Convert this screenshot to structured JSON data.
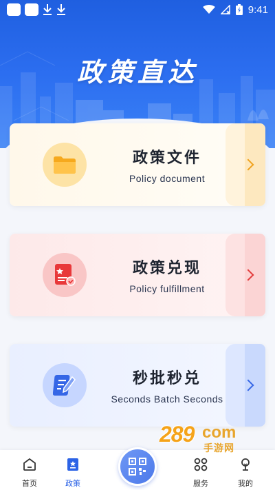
{
  "status_bar": {
    "time": "9:41"
  },
  "header": {
    "title": "政策直达"
  },
  "cards": [
    {
      "title": "政策文件",
      "subtitle": "Policy document",
      "icon": "folder-icon",
      "accent": "#f0a21e"
    },
    {
      "title": "政策兑现",
      "subtitle": "Policy fulfillment",
      "icon": "certificate-icon",
      "accent": "#e23a3a"
    },
    {
      "title": "秒批秒兑",
      "subtitle": "Seconds Batch Seconds",
      "icon": "document-edit-icon",
      "accent": "#3667e6"
    }
  ],
  "bottom_nav": {
    "items": [
      {
        "label": "首页",
        "icon": "home-icon"
      },
      {
        "label": "政策",
        "icon": "policy-icon",
        "active": true
      },
      {
        "label": "服务",
        "icon": "grid-icon"
      },
      {
        "label": "我的",
        "icon": "profile-icon"
      }
    ],
    "center_button": "qr-code-icon"
  },
  "watermark": {
    "number": "289",
    "suffix": "com",
    "text": "手游网"
  },
  "colors": {
    "primary": "#2c63e6",
    "header_top": "#1f5fe0"
  }
}
